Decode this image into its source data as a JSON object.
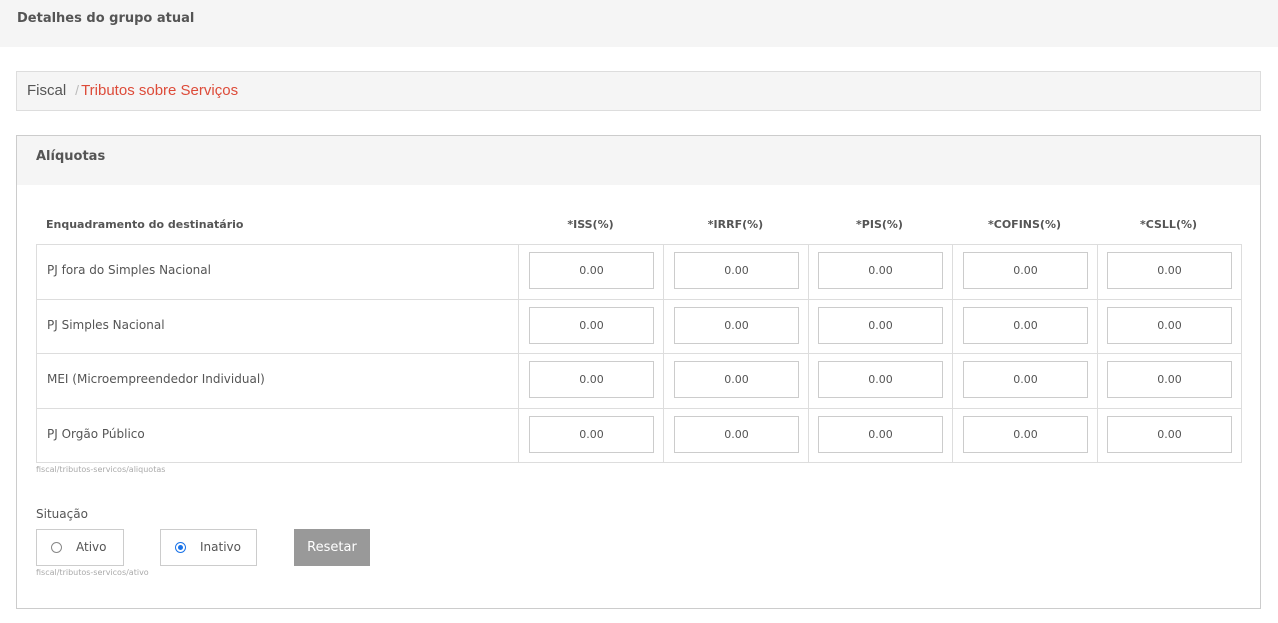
{
  "header": {
    "title": "Detalhes do grupo atual"
  },
  "breadcrumb": {
    "root": "Fiscal",
    "separator": "/",
    "active": "Tributos sobre Serviços"
  },
  "panel": {
    "title": "Alíquotas",
    "columns": [
      "Enquadramento do destinatário",
      "*ISS(%)",
      "*IRRF(%)",
      "*PIS(%)",
      "*COFINS(%)",
      "*CSLL(%)"
    ],
    "rows": [
      {
        "label": "PJ fora do Simples Nacional",
        "values": [
          "0.00",
          "0.00",
          "0.00",
          "0.00",
          "0.00"
        ]
      },
      {
        "label": "PJ Simples Nacional",
        "values": [
          "0.00",
          "0.00",
          "0.00",
          "0.00",
          "0.00"
        ]
      },
      {
        "label": "MEI (Microempreendedor Individual)",
        "values": [
          "0.00",
          "0.00",
          "0.00",
          "0.00",
          "0.00"
        ]
      },
      {
        "label": "PJ Orgão Público",
        "values": [
          "0.00",
          "0.00",
          "0.00",
          "0.00",
          "0.00"
        ]
      }
    ],
    "aliquotas_path": "fiscal/tributos-servicos/aliquotas"
  },
  "status": {
    "label": "Situação",
    "options": [
      {
        "label": "Ativo",
        "checked": false
      },
      {
        "label": "Inativo",
        "checked": true
      }
    ],
    "reset_label": "Resetar",
    "path": "fiscal/tributos-servicos/ativo"
  },
  "colors": {
    "accent": "#dd4b39",
    "radio": "#1a73e8",
    "button": "#999999"
  }
}
